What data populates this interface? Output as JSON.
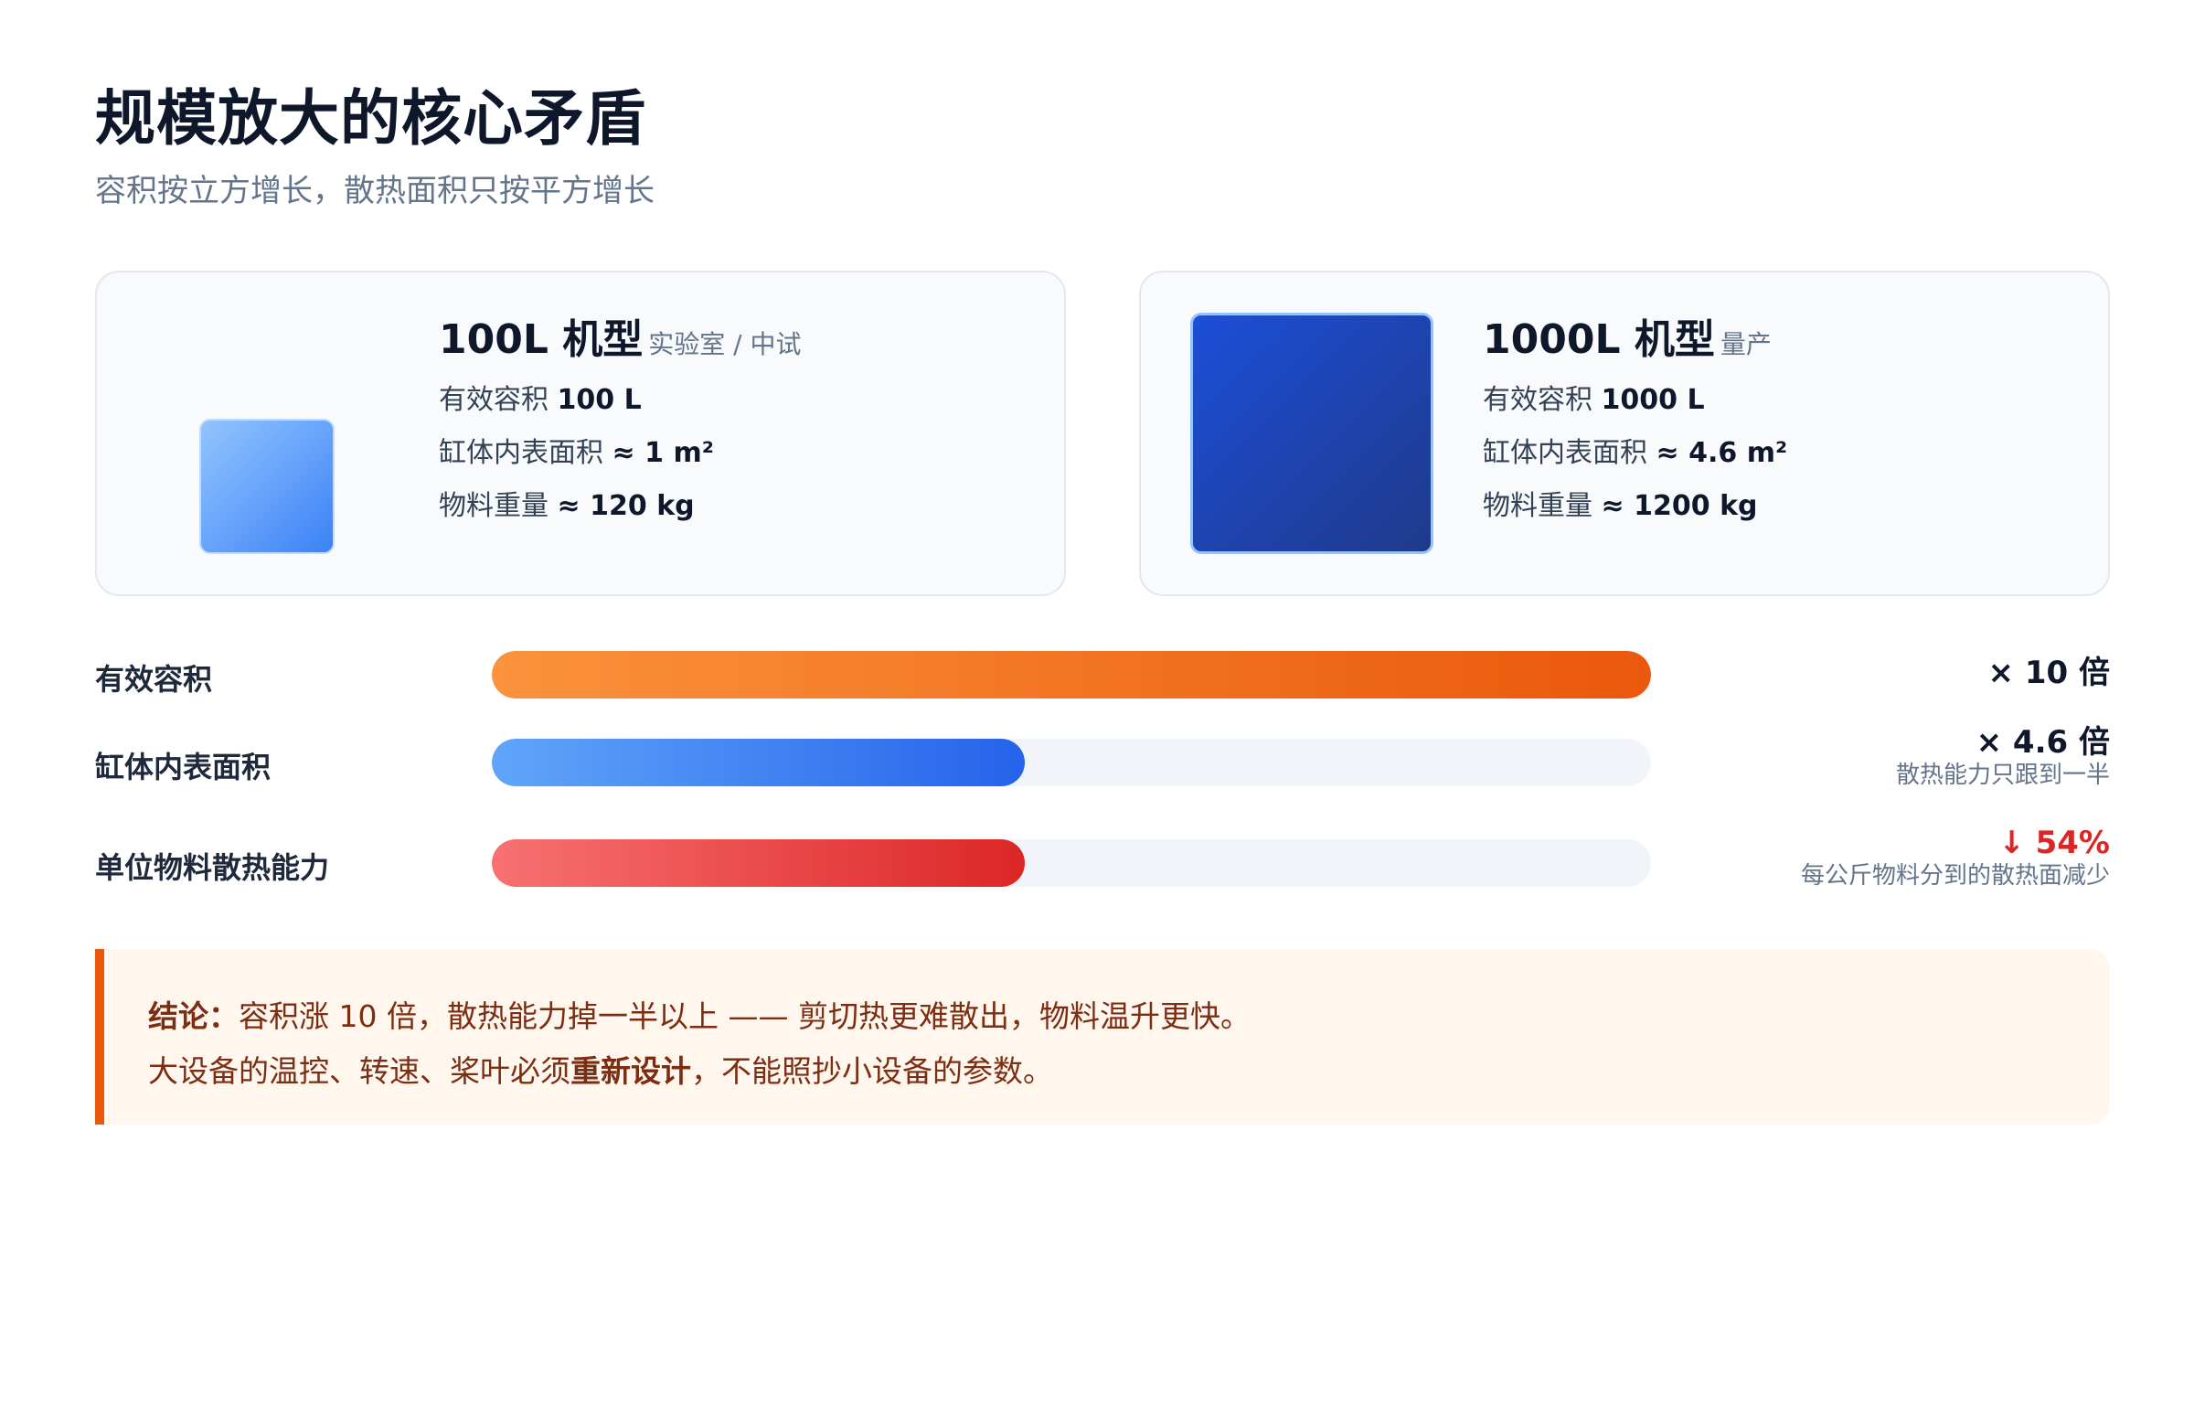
{
  "header": {
    "title": "规模放大的核心矛盾",
    "subtitle": "容积按立方增长，散热面积只按平方增长"
  },
  "cards": [
    {
      "title": "100L 机型",
      "tag": "实验室 / 中试",
      "specs": [
        {
          "label": "有效容积",
          "value": "100 L"
        },
        {
          "label": "缸体内表面积",
          "value": "≈ 1 m²"
        },
        {
          "label": "物料重量",
          "value": "≈ 120 kg"
        }
      ]
    },
    {
      "title": "1000L 机型",
      "tag": "量产",
      "specs": [
        {
          "label": "有效容积",
          "value": "1000 L"
        },
        {
          "label": "缸体内表面积",
          "value": "≈ 4.6 m²"
        },
        {
          "label": "物料重量",
          "value": "≈ 1200 kg"
        }
      ]
    }
  ],
  "comparison": [
    {
      "label": "有效容积",
      "fill_fraction": 1.0,
      "value": "× 10 倍",
      "note": "",
      "color": "#ea580c"
    },
    {
      "label": "缸体内表面积",
      "fill_fraction": 0.46,
      "value": "× 4.6 倍",
      "note": "散热能力只跟到一半",
      "color": "#2563eb"
    },
    {
      "label": "单位物料散热能力",
      "fill_fraction": 0.46,
      "value": "↓ 54%",
      "note": "每公斤物料分到的散热面减少",
      "color": "#dc2626"
    }
  ],
  "conclusion": {
    "prefix": "结论：",
    "line1": "容积涨 10 倍，散热能力掉一半以上 —— 剪切热更难散出，物料温升更快。",
    "line2_a": "大设备的温控、转速、桨叶必须",
    "line2_bold": "重新设计",
    "line2_b": "，不能照抄小设备的参数。"
  }
}
